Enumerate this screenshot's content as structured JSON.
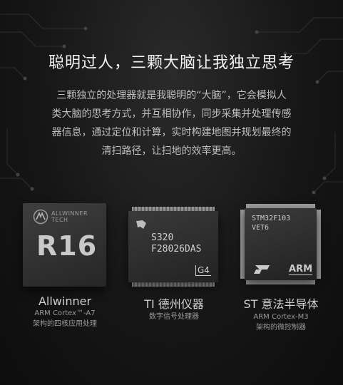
{
  "headline": "聪明过人，三颗大脑让我独立思考",
  "intro_lines": [
    "三颗独立的处理器就是我聪明的“大脑”，它会模拟人",
    "类大脑的思考方式，并互相协作，同步采集并处理传感",
    "器信息，通过定位和计算，实时构建地图并规划最终的",
    "清扫路径，让扫地的效率更高。"
  ],
  "chips": [
    {
      "logo_text": "ALLWINNER\nTECH",
      "model": "R16",
      "caption_brand": "Allwinner",
      "caption_sub1": "ARM Cortex™-A7",
      "caption_sub2": "架构的四核应用处理"
    },
    {
      "model_line1": "S320",
      "model_line2": "F28026DAS",
      "corner_mark": "G4",
      "caption_brand": "TI 德州仪器",
      "caption_sub1": "数字信号处理器"
    },
    {
      "model_line1": "STM32F103",
      "model_line2": "VET6",
      "arm_text": "ARM",
      "caption_brand": "ST 意法半导体",
      "caption_sub1": "ARM Cortex-M3",
      "caption_sub2": "架构的微控制器"
    }
  ]
}
